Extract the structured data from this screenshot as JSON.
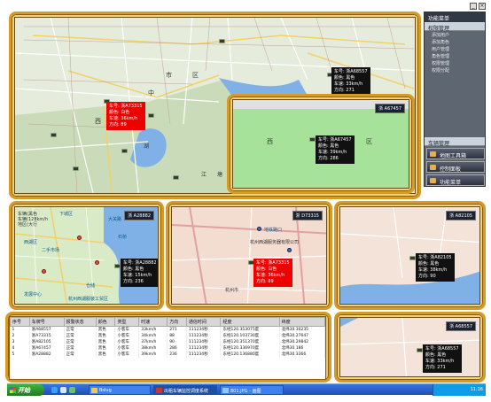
{
  "main_map": {
    "labels": [
      "西",
      "中",
      "市",
      "区",
      "湖",
      "江",
      "塘"
    ],
    "car_info": {
      "plate": "车号: 浙A73315",
      "color": "颜色: 白色",
      "speed": "车速: 36km/h",
      "direction": "方向: 89"
    },
    "car_info2": {
      "plate": "车号: 浙A68557",
      "color": "颜色: 黑色",
      "speed": "车速: 33km/h",
      "direction": "方向: 271"
    }
  },
  "popup": {
    "tag": "浙 A67457",
    "labels": [
      "西",
      "区"
    ],
    "car_info": {
      "plate": "车号: 浙A67457",
      "color": "颜色: 黑色",
      "speed": "车速: 39km/h",
      "direction": "方向: 286"
    }
  },
  "menu": {
    "title": "功能菜单",
    "section": "权限管理",
    "items": [
      "添加用户",
      "添加角色",
      "用户管理",
      "角色管理",
      "权限管理",
      "权限分配"
    ],
    "bottom_section": "车辆管理",
    "buttons": [
      "地图工具箱",
      "控制面板",
      "功能菜单"
    ]
  },
  "panel1": {
    "tag": "浙 A28882",
    "legend": [
      "车辆(黑色",
      "车辆(128km/h",
      "地区(大行"
    ],
    "labels": [
      "下城区",
      "大关路",
      "西湖区",
      "石桥",
      "杭州西湖服装工贸区",
      "二手市场",
      "发展中心",
      "仓储"
    ],
    "car_info": {
      "plate": "车号: 浙A28882",
      "color": "颜色: 黑色",
      "speed": "车速: 15km/h",
      "direction": "方向: 236"
    }
  },
  "panel2": {
    "tag": "浙 D73315",
    "labels": [
      "地铁路口",
      "杭州西湖服务器有限公司",
      "杭州市"
    ],
    "car_info": {
      "plate": "车号: 浙A73315",
      "color": "颜色: 白色",
      "speed": "车速: 36km/h",
      "direction": "方向: 89"
    }
  },
  "panel3": {
    "tag": "浙 A82105",
    "car_info": {
      "plate": "车号: 浙A82105",
      "color": "颜色: 黑色",
      "speed": "车速: 38km/h",
      "direction": "方向: 90"
    }
  },
  "panel4": {
    "tag": "浙 A68557",
    "car_info": {
      "plate": "车号: 浙A68557",
      "color": "颜色: 黑色",
      "speed": "车速: 33km/h",
      "direction": "方向: 271"
    }
  },
  "table": {
    "headers": [
      "序号",
      "车牌号",
      "报警状态",
      "颜色",
      "类型",
      "时速",
      "方向",
      "通信时间",
      "经度",
      "纬度"
    ],
    "rows": [
      [
        "1",
        "浙A68557",
        "正常",
        "黑色",
        "小客车",
        "33km/h",
        "271",
        "111234秒",
        "东经120.353075度",
        "北纬30.30235"
      ],
      [
        "2",
        "浙A73315",
        "正常",
        "黑色",
        "小客车",
        "34km/h",
        "88",
        "111234秒",
        "东经120.103730度",
        "北纬30.27647"
      ],
      [
        "3",
        "浙A82105",
        "正常",
        "黑色",
        "小客车",
        "37km/h",
        "90",
        "111234秒",
        "东经120.351370度",
        "北纬30.29842"
      ],
      [
        "4",
        "浙A67457",
        "正常",
        "黑色",
        "小客车",
        "38km/h",
        "286",
        "111234秒",
        "东经120.336970度",
        "北纬30.186"
      ],
      [
        "5",
        "浙A28882",
        "正常",
        "黑色",
        "小客车",
        "39km/h",
        "236",
        "111234秒",
        "东经120.136880度",
        "北纬30.3366"
      ]
    ]
  },
  "taskbar": {
    "start": "开始",
    "items": [
      "Bslug",
      "出租车辆监控调度系统",
      "801.JPG - 画图"
    ],
    "clock": "11:16"
  }
}
